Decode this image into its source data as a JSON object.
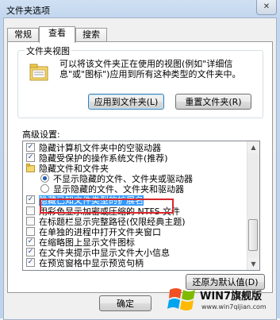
{
  "window": {
    "title": "文件夹选项",
    "close_glyph": "✕"
  },
  "tabs": [
    {
      "label": "常规"
    },
    {
      "label": "查看"
    },
    {
      "label": "搜索"
    }
  ],
  "folder_views": {
    "title": "文件夹视图",
    "description": "可以将该文件夹正在使用的视图(例如\"详细信息\"或\"图标\")应用到所有这种类型的文件夹中。",
    "apply_button": "应用到文件夹(L)",
    "reset_button": "重置文件夹(R)"
  },
  "advanced": {
    "label": "高级设置:",
    "items": [
      {
        "type": "checkbox",
        "checked": true,
        "text": "隐藏计算机文件夹中的空驱动器"
      },
      {
        "type": "checkbox",
        "checked": true,
        "text": "隐藏受保护的操作系统文件(推荐)"
      },
      {
        "type": "folder",
        "text": "隐藏文件和文件夹"
      },
      {
        "type": "radio",
        "checked": true,
        "text": "不显示隐藏的文件、文件夹或驱动器"
      },
      {
        "type": "radio",
        "checked": false,
        "text": "显示隐藏的文件、文件夹和驱动器"
      },
      {
        "type": "checkbox",
        "checked": true,
        "text": "隐藏已知文件类型的扩展名"
      },
      {
        "type": "checkbox",
        "checked": false,
        "text": "用彩色显示加密或压缩的 NTFS 文件"
      },
      {
        "type": "checkbox",
        "checked": false,
        "text": "在标题栏显示完整路径(仅限经典主题)"
      },
      {
        "type": "checkbox",
        "checked": false,
        "text": "在单独的进程中打开文件夹窗口"
      },
      {
        "type": "checkbox",
        "checked": true,
        "text": "在缩略图上显示文件图标"
      },
      {
        "type": "checkbox",
        "checked": true,
        "text": "在文件夹提示中显示文件大小信息"
      },
      {
        "type": "checkbox",
        "checked": true,
        "text": "在预览窗格中显示预览句柄"
      }
    ]
  },
  "restore_button": "还原为默认值(D)",
  "footer": {
    "ok_button": "确定"
  },
  "watermark": {
    "brand": "WIN7旗舰版",
    "url": "www.win7qijian.com"
  },
  "check_glyph": "✓"
}
